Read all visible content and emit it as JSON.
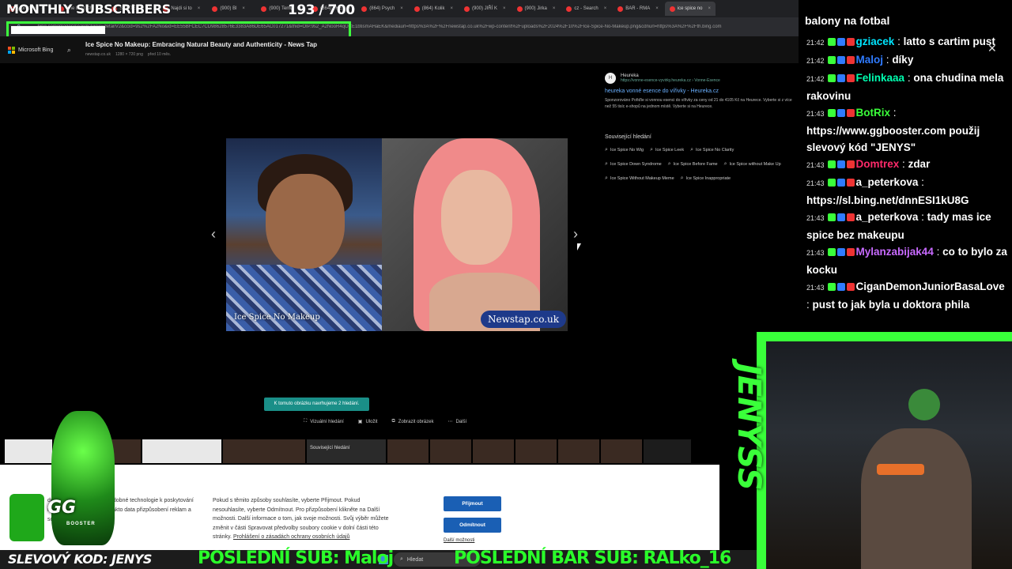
{
  "overlay": {
    "monthly_subscribers_label": "MONTHLY SUBSCRIBERS",
    "sub_count": "193 / 700",
    "sub_progress": 0.2757,
    "promo_code": "SLEVOVÝ KOD: JENYS",
    "last_sub": "POSLEDNÍ SUB: Maloj",
    "last_bar_sub": "POSLEDNÍ BAR SUB: RALko_16",
    "side_name": "JENYSS",
    "mascot_text": "GG",
    "mascot_subtext": "BOOSTER"
  },
  "browser": {
    "tabs": [
      {
        "label": "y předvo"
      },
      {
        "label": "The best Ch"
      },
      {
        "label": "SOUTĚŽ O"
      },
      {
        "label": "Najdi si to"
      },
      {
        "label": "(900) Bl"
      },
      {
        "label": "(900) Temů"
      },
      {
        "label": "(864) THE"
      },
      {
        "label": "(864) Psych"
      },
      {
        "label": "(864) Kolik"
      },
      {
        "label": "(900) JIŘÍ K"
      },
      {
        "label": "(900) Jirka"
      },
      {
        "label": "cz - Search"
      },
      {
        "label": "BAR - RMA"
      },
      {
        "label": "ice spice no"
      }
    ],
    "url": "bing.com/images/search?view=detailV2&ccid=9s2%2FA2No&id=EE55BFCEC7CD98628576E3383A86DE65AC017271&thid=OIP.9s2_A2NooR4qOCE1btismAHaEK&mediaurl=https%3A%2F%2Fnewstap.co.uk%2Fwp-content%2Fuploads%2F2024%2F10%2FIce-Spice-No-Makeup.png&cdnurl=https%3A%2F%2Fth.bing.com"
  },
  "bing": {
    "brand": "Microsoft Bing",
    "page_title": "Ice Spice No Makeup: Embracing Natural Beauty and Authenticity - News Tap",
    "meta": [
      "newstap.co.uk",
      "1280 × 720 png",
      "před 10 měs."
    ],
    "caption_left": "Ice Spice No Makeup",
    "caption_right": "Newstap.co.uk",
    "ad": {
      "icon": "H",
      "name": "Heureka",
      "url": "https://vonne-esence-vyvirky.heureka.cz › Vonne-Esence",
      "title": "heureka vonné esence do vířivky - Heureka.cz",
      "sponsored_label": "Sponzorováno",
      "text": "Pořiďte si vonnou esenci do vířivky za ceny od 21 do 4105 Kč na Heurece. Vyberte si z více než 55 tisíc e-shopů na jednom místě. Vyberte si na Heurece."
    },
    "related_title": "Související hledání",
    "related": [
      "Ice Spice No Wig",
      "Ice Spice Leek",
      "Ice Spice No Clarity",
      "Ice Spice Down Syndrome",
      "Ice Spice Before Fame",
      "Ice Spice without Make Up",
      "Ice Spice Without Makeup Meme",
      "Ice Spice Inappropriate"
    ],
    "suggest_pill": "K tomuto obrázku navrhujeme 2 hledání.",
    "actions": [
      "Vizuální hledání",
      "Uložit",
      "Zobrazit obrázek",
      "Další"
    ],
    "thumb_related_label": "Související hledání"
  },
  "cookie": {
    "left_text": "dodavatelé třetích stran podobné technologie k poskytování našich služeb a souhlasu takto data přizpůsobení reklam a související analýzám.",
    "text": "Pokud s těmito způsoby souhlasíte, vyberte Přijmout. Pokud nesouhlasíte, vyberte Odmítnout. Pro přizpůsobení klikněte na Další možnosti. Další informace o tom, jak svoje možnosti. Svůj výběr můžete změnit v části Spravovat předvolby soubory cookie v dolní části této stránky.",
    "link": "Prohlášení o zásadách ochrany osobních údajů",
    "accept": "Přijmout",
    "reject": "Odmítnout",
    "more": "Další možnosti"
  },
  "chat": {
    "header": "balony na fotbal",
    "messages": [
      {
        "time": "21:42",
        "user": "gziacek",
        "color": "#00e5ff",
        "msg": "latto s cartim pust"
      },
      {
        "time": "21:42",
        "user": "Maloj",
        "color": "#2f7bff",
        "msg": "díky"
      },
      {
        "time": "21:42",
        "user": "Felinkaaa",
        "color": "#00ffb0",
        "msg": "ona chudina mela rakovinu"
      },
      {
        "time": "21:43",
        "user": "BotRix",
        "color": "#3aff3a",
        "msg": "https://www.ggbooster.com použij slevový kód \"JENYS\""
      },
      {
        "time": "21:43",
        "user": "Domtrex",
        "color": "#ff2a6a",
        "msg": "zdar"
      },
      {
        "time": "21:43",
        "user": "a_peterkova",
        "color": "#ffffff",
        "msg": "https://sl.bing.net/dnnESI1kU8G"
      },
      {
        "time": "21:43",
        "user": "a_peterkova",
        "color": "#ffffff",
        "msg": "tady mas ice spice bez makeupu"
      },
      {
        "time": "21:43",
        "user": "Mylanzabijak44",
        "color": "#c86aff",
        "msg": "co to bylo za kocku"
      },
      {
        "time": "21:43",
        "user": "CiganDemonJuniorBasaLove",
        "color": "#ffffff",
        "msg": "pust to jak byla u doktora phila"
      }
    ]
  },
  "taskbar": {
    "search_placeholder": "Hledat"
  },
  "colors": {
    "accent_green": "#3aff3a",
    "bing_button": "#1a5fb4",
    "suggest_teal": "#1a8f88"
  }
}
